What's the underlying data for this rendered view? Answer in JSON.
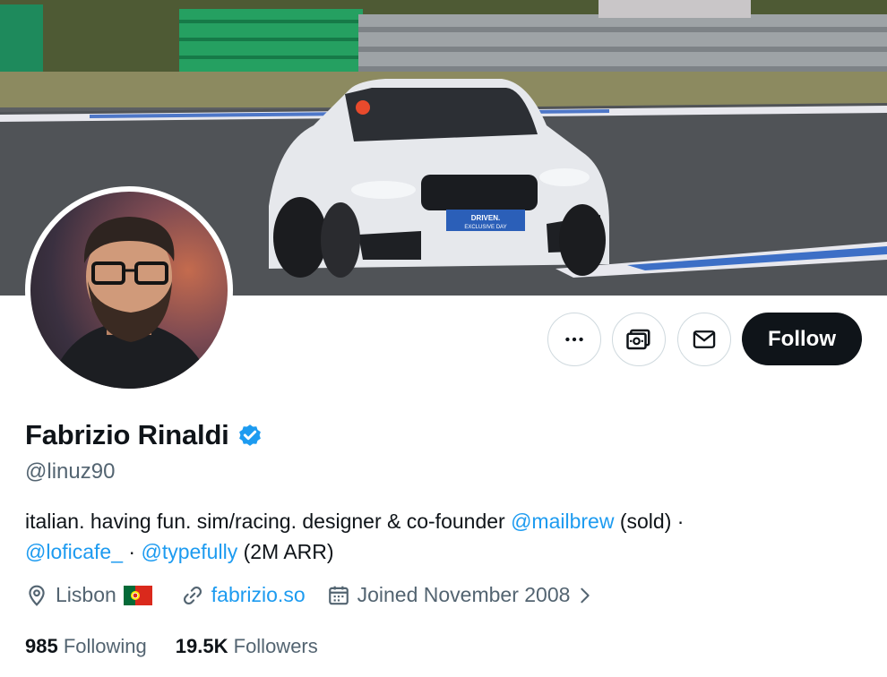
{
  "profile": {
    "name": "Fabrizio Rinaldi",
    "handle": "@linuz90",
    "bio": {
      "part1": "italian. having fun. sim/racing. designer & co-founder ",
      "mention1": "@mailbrew",
      "part2": " (sold) ·",
      "mention2": "@loficafe_",
      "sep": " · ",
      "mention3": "@typefully",
      "part3": " (2M ARR)"
    },
    "location": "Lisbon",
    "website": "fabrizio.so",
    "joined": "Joined November 2008",
    "following_count": "985",
    "following_label": "Following",
    "followers_count": "19.5K",
    "followers_label": "Followers"
  },
  "actions": {
    "follow_label": "Follow"
  },
  "banner": {
    "plate_line1": "DRIVEN.",
    "plate_line2": "EXCLUSIVE DAY"
  },
  "colors": {
    "link": "#1d9bf0",
    "follow_bg": "#0f1419",
    "muted": "#536471"
  },
  "icons": [
    "more-icon",
    "subscribe-icon",
    "message-icon",
    "verified-icon",
    "location-icon",
    "flag-portugal-icon",
    "link-icon",
    "calendar-icon",
    "chevron-right-icon"
  ]
}
